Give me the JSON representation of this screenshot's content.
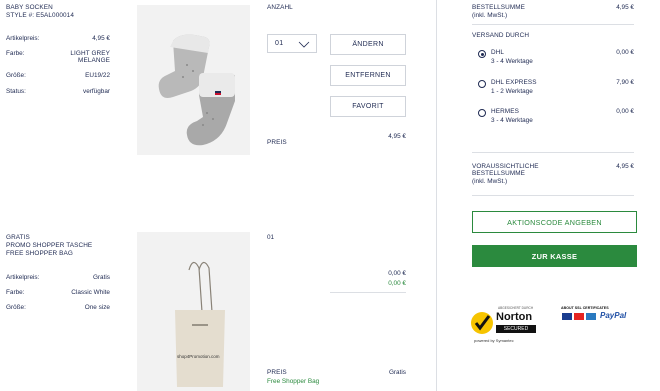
{
  "item1": {
    "name": "BABY SOCKEN",
    "style": "STYLE #: E5AL000014",
    "details": [
      {
        "label": "Artikelpreis:",
        "value": "4,95 €"
      },
      {
        "label": "Farbe:",
        "value": "LIGHT GREY\nMELANGE"
      },
      {
        "label": "Größe:",
        "value": "EU19/22"
      },
      {
        "label": "Status:",
        "value": "verfügbar"
      }
    ],
    "qty_label": "ANZAHL",
    "qty_value": "01",
    "buttons": {
      "change": "ÄNDERN",
      "remove": "ENTFERNEN",
      "favorite": "FAVORIT"
    },
    "price_label": "PREIS",
    "price_value": "4,95 €"
  },
  "item2": {
    "line1": "GRATIS",
    "line2": "PROMO SHOPPER TASCHE",
    "line3": "FREE SHOPPER BAG",
    "details": [
      {
        "label": "Artikelpreis:",
        "value": "Gratis"
      },
      {
        "label": "Farbe:",
        "value": "Classic White"
      },
      {
        "label": "Größe:",
        "value": "One size"
      }
    ],
    "qty_value": "01",
    "price_a": "0,00 €",
    "price_b": "0,00 €",
    "bag_text": "shop4Promotion.com",
    "price_label": "PREIS",
    "price_value": "Gratis",
    "promo_note": "Free Shopper Bag"
  },
  "summary": {
    "subtotal_label": "BESTELLSUMME",
    "subtotal_note": "(inkl. MwSt.)",
    "subtotal_value": "4,95 €",
    "shipping_title": "VERSAND DURCH",
    "shipping_options": [
      {
        "name": "DHL",
        "time": "3 - 4 Werktage",
        "price": "0,00 €",
        "selected": true
      },
      {
        "name": "DHL EXPRESS",
        "time": "1 - 2 Werktage",
        "price": "7,90 €",
        "selected": false
      },
      {
        "name": "HERMES",
        "time": "3 - 4 Werktage",
        "price": "0,00 €",
        "selected": false
      }
    ],
    "total_label_1": "VORAUSSICHTLICHE",
    "total_label_2": "BESTELLSUMME",
    "total_note": "(inkl. MwSt.)",
    "total_value": "4,95 €",
    "promo_button": "AKTIONSCODE ANGEBEN",
    "checkout_button": "ZUR KASSE",
    "colors": {
      "accent": "#2b8a3e",
      "text": "#1f2a52"
    }
  },
  "badges": {
    "norton_top": "ABGESICHERT DURCH",
    "norton_name": "Norton",
    "norton_secured": "SECURED",
    "norton_powered": "powered by Symantec",
    "payments_title": "ABOUT SSL CERTIFICATES",
    "paypal": "PayPal"
  }
}
